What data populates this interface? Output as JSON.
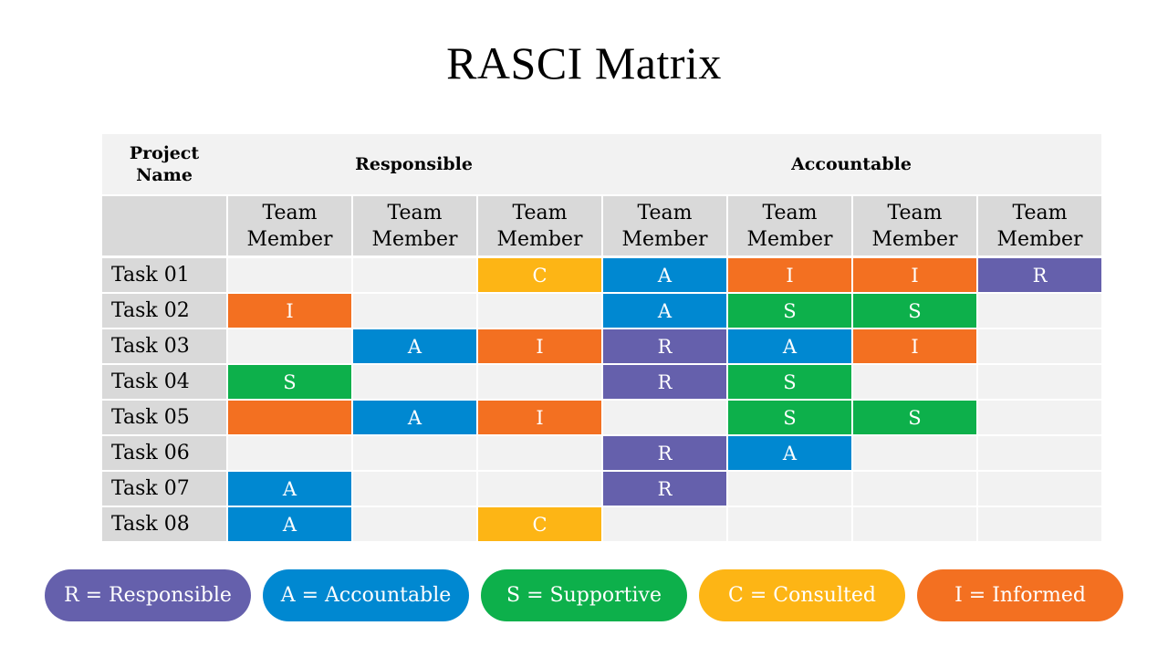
{
  "title": "RASCI Matrix",
  "colors": {
    "R": "#6560ac",
    "A": "#0088d1",
    "S": "#0db04b",
    "C": "#fdb515",
    "I": "#f37021"
  },
  "header": {
    "project_name": "Project Name",
    "group_responsible": "Responsible",
    "group_accountable": "Accountable",
    "columns": [
      "Team Member",
      "Team Member",
      "Team Member",
      "Team Member",
      "Team Member",
      "Team Member",
      "Team Member"
    ]
  },
  "rows": [
    {
      "task": "Task 01",
      "cells": [
        null,
        null,
        {
          "text": "C",
          "role": "C"
        },
        {
          "text": "A",
          "role": "A"
        },
        {
          "text": "I",
          "role": "I"
        },
        {
          "text": "I",
          "role": "I"
        },
        {
          "text": "R",
          "role": "R"
        }
      ]
    },
    {
      "task": "Task 02",
      "cells": [
        {
          "text": "I",
          "role": "I"
        },
        null,
        null,
        {
          "text": "A",
          "role": "A"
        },
        {
          "text": "S",
          "role": "S"
        },
        {
          "text": "S",
          "role": "S"
        },
        null
      ]
    },
    {
      "task": "Task 03",
      "cells": [
        null,
        {
          "text": "A",
          "role": "A"
        },
        {
          "text": "I",
          "role": "I"
        },
        {
          "text": "R",
          "role": "R"
        },
        {
          "text": "A",
          "role": "A"
        },
        {
          "text": "I",
          "role": "I"
        },
        null
      ]
    },
    {
      "task": "Task 04",
      "cells": [
        {
          "text": "S",
          "role": "S"
        },
        null,
        null,
        {
          "text": "R",
          "role": "R"
        },
        {
          "text": "S",
          "role": "S"
        },
        null,
        null
      ]
    },
    {
      "task": "Task 05",
      "cells": [
        {
          "text": "",
          "role": "I"
        },
        {
          "text": "A",
          "role": "A"
        },
        {
          "text": "I",
          "role": "I"
        },
        null,
        {
          "text": "S",
          "role": "S"
        },
        {
          "text": "S",
          "role": "S"
        },
        null
      ]
    },
    {
      "task": "Task 06",
      "cells": [
        null,
        null,
        null,
        {
          "text": "R",
          "role": "R"
        },
        {
          "text": "A",
          "role": "A"
        },
        null,
        null
      ]
    },
    {
      "task": "Task 07",
      "cells": [
        {
          "text": "A",
          "role": "A"
        },
        null,
        null,
        {
          "text": "R",
          "role": "R"
        },
        null,
        null,
        null
      ]
    },
    {
      "task": "Task 08",
      "cells": [
        {
          "text": "A",
          "role": "A"
        },
        null,
        {
          "text": "C",
          "role": "C"
        },
        null,
        null,
        null,
        null
      ]
    }
  ],
  "legend": [
    {
      "role": "R",
      "label": "R = Responsible"
    },
    {
      "role": "A",
      "label": "A = Accountable"
    },
    {
      "role": "S",
      "label": "S = Supportive"
    },
    {
      "role": "C",
      "label": "C = Consulted"
    },
    {
      "role": "I",
      "label": "I = Informed"
    }
  ]
}
